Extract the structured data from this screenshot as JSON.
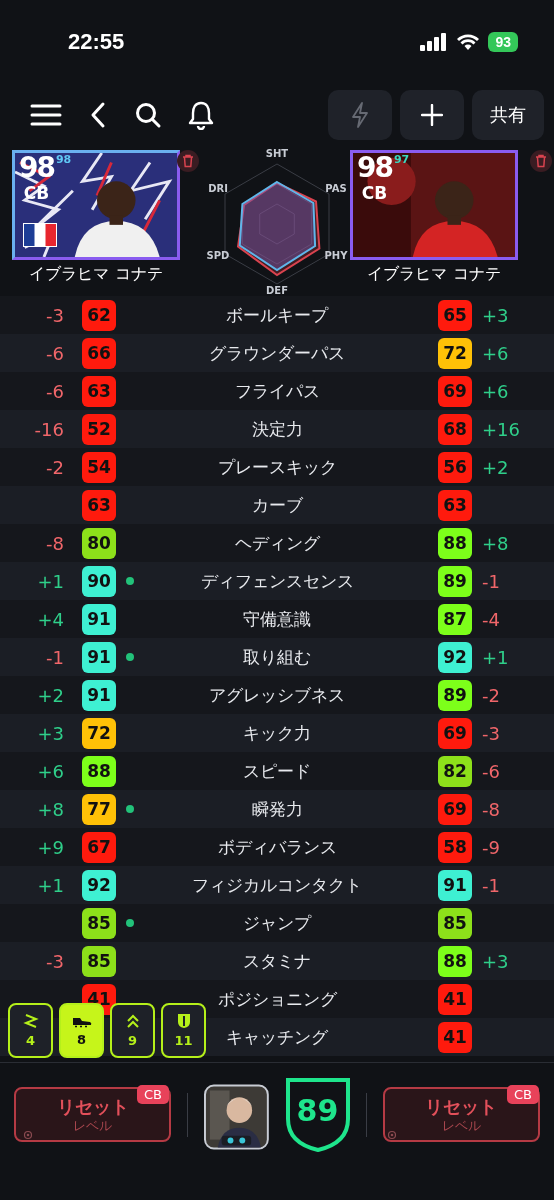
{
  "status_bar": {
    "time": "22:55",
    "battery": "93"
  },
  "toolbar": {
    "share_label": "共有"
  },
  "players": [
    {
      "rating": "98",
      "sub_rating": "98",
      "position": "CB",
      "name": "イブラヒマ コナテ",
      "flag": true
    },
    {
      "rating": "98",
      "sub_rating": "97",
      "position": "CB",
      "name": "イブラヒマ コナテ",
      "flag": false
    }
  ],
  "radar": {
    "labels": [
      "SHT",
      "PAS",
      "PHY",
      "DEF",
      "SPD",
      "DRI"
    ]
  },
  "rows": [
    {
      "label": "ボールキープ",
      "dot": false,
      "left": {
        "value": "62",
        "diff": "-3",
        "color": "#f0666a"
      },
      "right": {
        "value": "65",
        "diff": "+3",
        "color": "#2fcf8a"
      }
    },
    {
      "label": "グラウンダーパス",
      "dot": false,
      "left": {
        "value": "66",
        "diff": "-6",
        "color": "#f0666a"
      },
      "right": {
        "value": "72",
        "diff": "+6",
        "color": "#2fcf8a"
      }
    },
    {
      "label": "フライパス",
      "dot": false,
      "left": {
        "value": "63",
        "diff": "-6",
        "color": "#f0666a"
      },
      "right": {
        "value": "69",
        "diff": "+6",
        "color": "#2fcf8a"
      }
    },
    {
      "label": "決定力",
      "dot": false,
      "left": {
        "value": "52",
        "diff": "-16",
        "color": "#f0666a"
      },
      "right": {
        "value": "68",
        "diff": "+16",
        "color": "#2fcf8a"
      }
    },
    {
      "label": "プレースキック",
      "dot": false,
      "left": {
        "value": "54",
        "diff": "-2",
        "color": "#f0666a"
      },
      "right": {
        "value": "56",
        "diff": "+2",
        "color": "#2fcf8a"
      }
    },
    {
      "label": "カーブ",
      "dot": false,
      "left": {
        "value": "63"
      },
      "right": {
        "value": "63"
      }
    },
    {
      "label": "ヘディング",
      "dot": false,
      "left": {
        "value": "80",
        "diff": "-8",
        "color": "#f0666a"
      },
      "right": {
        "value": "88",
        "diff": "+8",
        "color": "#2fcf8a"
      }
    },
    {
      "label": "ディフェンスセンス",
      "dot": true,
      "left": {
        "value": "90",
        "diff": "+1",
        "color": "#2fcf8a"
      },
      "right": {
        "value": "89",
        "diff": "-1",
        "color": "#f0666a"
      }
    },
    {
      "label": "守備意識",
      "dot": false,
      "left": {
        "value": "91",
        "diff": "+4",
        "color": "#2fcf8a"
      },
      "right": {
        "value": "87",
        "diff": "-4",
        "color": "#f0666a"
      }
    },
    {
      "label": "取り組む",
      "dot": true,
      "left": {
        "value": "91",
        "diff": "-1",
        "color": "#f0666a"
      },
      "right": {
        "value": "92",
        "diff": "+1",
        "color": "#2fcf8a"
      }
    },
    {
      "label": "アグレッシブネス",
      "dot": false,
      "left": {
        "value": "91",
        "diff": "+2",
        "color": "#2fcf8a"
      },
      "right": {
        "value": "89",
        "diff": "-2",
        "color": "#f0666a"
      }
    },
    {
      "label": "キック力",
      "dot": false,
      "left": {
        "value": "72",
        "diff": "+3",
        "color": "#2fcf8a"
      },
      "right": {
        "value": "69",
        "diff": "-3",
        "color": "#f0666a"
      }
    },
    {
      "label": "スピード",
      "dot": false,
      "left": {
        "value": "88",
        "diff": "+6",
        "color": "#2fcf8a"
      },
      "right": {
        "value": "82",
        "diff": "-6",
        "color": "#f0666a"
      }
    },
    {
      "label": "瞬発力",
      "dot": true,
      "left": {
        "value": "77",
        "diff": "+8",
        "color": "#2fcf8a"
      },
      "right": {
        "value": "69",
        "diff": "-8",
        "color": "#f0666a"
      }
    },
    {
      "label": "ボディバランス",
      "dot": false,
      "left": {
        "value": "67",
        "diff": "+9",
        "color": "#2fcf8a"
      },
      "right": {
        "value": "58",
        "diff": "-9",
        "color": "#f0666a"
      }
    },
    {
      "label": "フィジカルコンタクト",
      "dot": false,
      "left": {
        "value": "92",
        "diff": "+1",
        "color": "#2fcf8a"
      },
      "right": {
        "value": "91",
        "diff": "-1",
        "color": "#f0666a"
      }
    },
    {
      "label": "ジャンプ",
      "dot": true,
      "left": {
        "value": "85"
      },
      "right": {
        "value": "85"
      }
    },
    {
      "label": "スタミナ",
      "dot": false,
      "left": {
        "value": "85",
        "diff": "-3",
        "color": "#f0666a"
      },
      "right": {
        "value": "88",
        "diff": "+3",
        "color": "#2fcf8a"
      }
    },
    {
      "label": "ポジショニング",
      "dot": false,
      "left": {
        "value": "41"
      },
      "right": {
        "value": "41"
      }
    },
    {
      "label": "キャッチング",
      "dot": false,
      "right": {
        "value": "41"
      }
    }
  ],
  "filters": [
    {
      "kind": "zigzag",
      "count": "4",
      "selected": false
    },
    {
      "kind": "boot",
      "count": "8",
      "selected": true
    },
    {
      "kind": "chevrons",
      "count": "9",
      "selected": false
    },
    {
      "kind": "shield",
      "count": "11",
      "selected": false
    }
  ],
  "bottom": {
    "resets": [
      {
        "label": "リセット",
        "sub": "レベル",
        "tag": "CB"
      },
      {
        "label": "リセット",
        "sub": "レベル",
        "tag": "CB"
      }
    ],
    "team_rating": "89"
  }
}
